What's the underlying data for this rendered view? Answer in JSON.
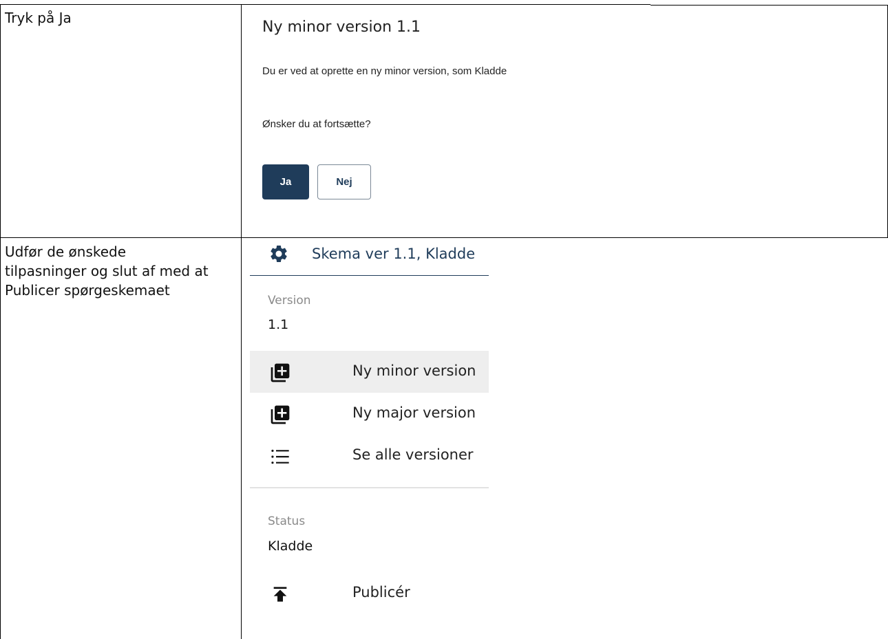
{
  "rows": [
    {
      "instruction": "Tryk på Ja"
    },
    {
      "instruction": "Udfør de ønskede tilpasninger og slut af med at Publicer spørgeskemaet"
    }
  ],
  "dialog": {
    "title": "Ny minor version 1.1",
    "message": "Du er ved at oprette en ny minor version, som Kladde",
    "question": "Ønsker du at fortsætte?",
    "yes_label": "Ja",
    "no_label": "Nej",
    "primary_color": "#1f3c5a"
  },
  "panel": {
    "header_icon": "gear-icon",
    "header_title": "Skema ver 1.1, Kladde",
    "version_label": "Version",
    "version_value": "1.1",
    "menu": [
      {
        "icon": "library-add-icon",
        "label": "Ny minor version",
        "active": true
      },
      {
        "icon": "library-add-icon",
        "label": "Ny major version",
        "active": false
      },
      {
        "icon": "list-icon",
        "label": "Se alle versioner",
        "active": false
      }
    ],
    "status_label": "Status",
    "status_value": "Kladde",
    "publish": {
      "icon": "publish-icon",
      "label": "Publicér"
    }
  }
}
